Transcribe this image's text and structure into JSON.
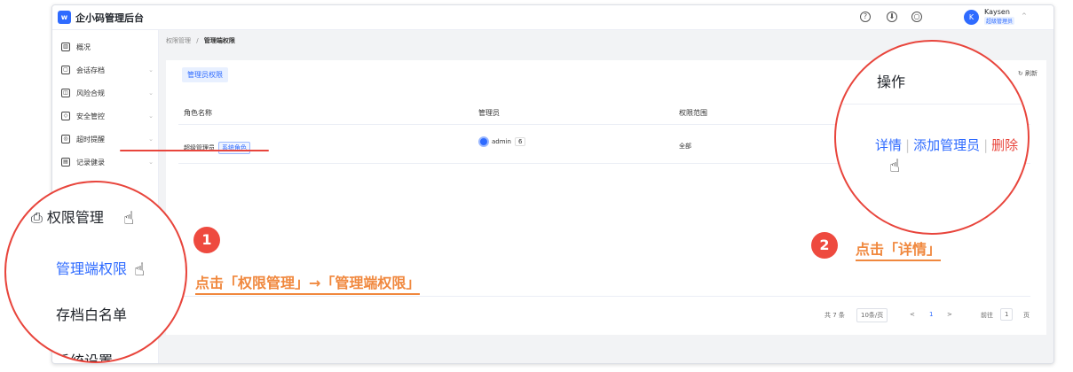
{
  "app": {
    "logo_glyph": "w",
    "title": "企小码管理后台"
  },
  "topbar": {
    "help_icon": "?",
    "cloud_icon": "⬇",
    "refresh_icon": "○",
    "avatar_initial": "K",
    "user_name": "Kaysen",
    "user_role": "超级管理员",
    "caret": "^"
  },
  "sidebar": {
    "items": [
      {
        "label": "概况",
        "icon": "▥",
        "chevron": ""
      },
      {
        "label": "会话存档",
        "icon": "▢",
        "chevron": "⌄"
      },
      {
        "label": "风险合规",
        "icon": "◫",
        "chevron": "⌄"
      },
      {
        "label": "安全管控",
        "icon": "◇",
        "chevron": "⌄"
      },
      {
        "label": "超时提醒",
        "icon": "◎",
        "chevron": "⌄"
      },
      {
        "label": "记录健录",
        "icon": "▤",
        "chevron": "⌄"
      }
    ]
  },
  "breadcrumb": {
    "parent": "权限管理",
    "separator": "/",
    "current": "管理端权限"
  },
  "panel": {
    "tab_label": "管理员权限",
    "refresh_label": "刷新",
    "columns": [
      "角色名称",
      "管理员",
      "权限范围"
    ],
    "row": {
      "role": "超级管理员",
      "role_tag": "系统角色",
      "admin_name": "admin",
      "admin_count": "6",
      "scope": "全部"
    }
  },
  "pagination": {
    "total": "共 7 条",
    "page_size": "10条/页",
    "prev": "<",
    "current_page": "1",
    "next": ">",
    "goto_label": "前往",
    "goto_value": "1",
    "page_unit": "页"
  },
  "zoom_left": {
    "group_label": "权限管理",
    "items": [
      "管理端权限",
      "存档白名单",
      "系统设置"
    ]
  },
  "zoom_right": {
    "title": "操作",
    "action_detail": "详情",
    "action_add": "添加管理员",
    "action_delete": "删除",
    "separator": "|"
  },
  "annotations": {
    "step1_number": "1",
    "step1_text": "点击「权限管理」→「管理端权限」",
    "step2_number": "2",
    "step2_text": "点击「详情」"
  },
  "colors": {
    "accent": "#2f6bff",
    "danger": "#e8453c",
    "annotation": "#f0883e"
  },
  "icons": {
    "pointer": "hand-pointer-icon"
  }
}
